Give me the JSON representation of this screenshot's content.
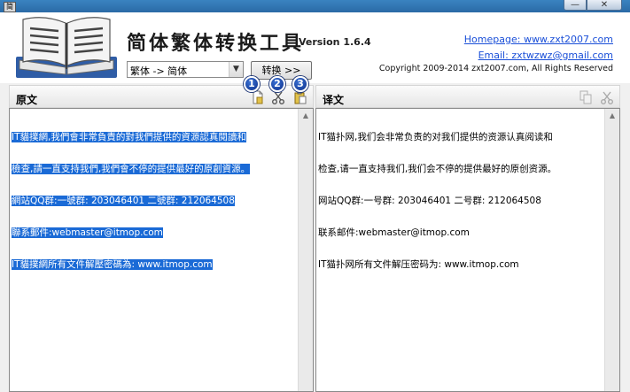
{
  "window": {
    "min_label": "—",
    "close_label": "✕",
    "icon_text": "简"
  },
  "header": {
    "title": "简体繁体转换工具",
    "version": "Version 1.6.4",
    "homepage": "Homepage: www.zxt2007.com",
    "email": "Email: zxtwzwz@gmail.com",
    "copyright": "Copyright 2009-2014 zxt2007.com, All Rights Reserved",
    "mode_select": "繁体 -> 简体",
    "convert_button": "转换 >>"
  },
  "left_pane": {
    "title": "原文",
    "icons": [
      "new-icon",
      "cut-icon",
      "paste-icon"
    ],
    "badges": [
      "1",
      "2",
      "3"
    ],
    "lines": [
      "IT貓撲網,我們會非常負責的對我們提供的資源認真閱讀和",
      "檢查,請一直支持我們,我們會不停的提供最好的原創資源。",
      "網站QQ群:一號群: 203046401 二號群: 212064508",
      "聯系郵件:webmaster@itmop.com",
      "IT貓撲網所有文件解壓密碼為: www.itmop.com"
    ]
  },
  "right_pane": {
    "title": "译文",
    "icons": [
      "copy-icon",
      "cut-icon"
    ],
    "lines": [
      "IT猫扑网,我们会非常负责的对我们提供的资源认真阅读和",
      "检查,请一直支持我们,我们会不停的提供最好的原创资源。",
      "网站QQ群:一号群: 203046401 二号群: 212064508",
      "联系邮件:webmaster@itmop.com",
      "IT猫扑网所有文件解压密码为: www.itmop.com"
    ]
  },
  "colors": {
    "selection": "#1a6ad6",
    "link": "#1a4fd8",
    "badge": "#0d2f8a",
    "titlebar": "#2a6aa6"
  }
}
